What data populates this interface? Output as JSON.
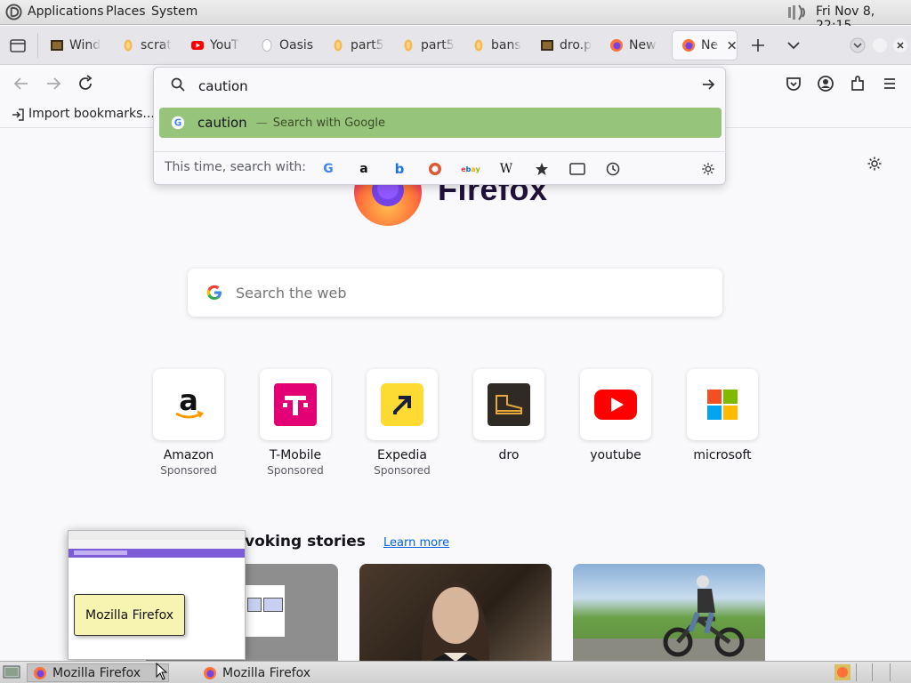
{
  "os_panel": {
    "menus": [
      "Applications",
      "Places",
      "System"
    ],
    "clock": "Fri Nov 8, 22:15"
  },
  "tabs": [
    {
      "label": "Wind",
      "icon": "film-strip-icon"
    },
    {
      "label": "scrat",
      "icon": "coin-icon"
    },
    {
      "label": "YouT",
      "icon": "youtube-icon"
    },
    {
      "label": "Oasis",
      "icon": "blank-page-icon"
    },
    {
      "label": "part5",
      "icon": "coin-icon"
    },
    {
      "label": "part5",
      "icon": "coin-icon"
    },
    {
      "label": "bans",
      "icon": "coin-icon"
    },
    {
      "label": "dro.p",
      "icon": "film-strip-icon"
    },
    {
      "label": "New",
      "icon": "firefox-icon"
    },
    {
      "label": "Ne",
      "icon": "firefox-icon",
      "active": true
    }
  ],
  "bookmarks_bar": {
    "import_label": "Import bookmarks..."
  },
  "urlbar": {
    "value": "caution",
    "suggestion": {
      "text": "caution",
      "separator": "—",
      "action": "Search with Google"
    },
    "search_with_label": "This time, search with:",
    "engines": [
      "google",
      "amazon",
      "bing",
      "duckduckgo",
      "ebay",
      "wikipedia",
      "bookmarks",
      "tabs",
      "history"
    ]
  },
  "newtab": {
    "brand": "Firefox",
    "search_placeholder": "Search the web",
    "shortcuts": [
      {
        "title": "Amazon",
        "sub": "Sponsored"
      },
      {
        "title": "T-Mobile",
        "sub": "Sponsored"
      },
      {
        "title": "Expedia",
        "sub": "Sponsored"
      },
      {
        "title": "dro",
        "sub": ""
      },
      {
        "title": "youtube",
        "sub": ""
      },
      {
        "title": "microsoft",
        "sub": ""
      }
    ],
    "stories_heading": "voking stories",
    "learn_more": "Learn more"
  },
  "taskbar": {
    "items": [
      "Mozilla Firefox",
      "Mozilla Firefox"
    ],
    "tooltip": "Mozilla Firefox"
  },
  "colors": {
    "suggest_highlight": "#96c47a",
    "firefox_orange": "#ff7139",
    "link": "#0061e0"
  }
}
